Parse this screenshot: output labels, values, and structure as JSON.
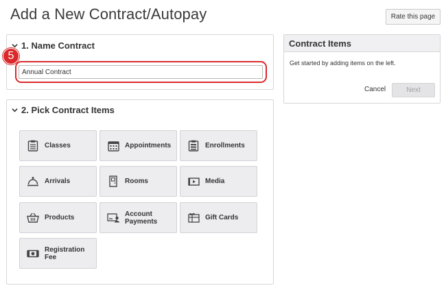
{
  "page": {
    "title": "Add a New Contract/Autopay",
    "rate_button": "Rate this page"
  },
  "name_section": {
    "heading": "1. Name Contract",
    "input_value": "Annual Contract",
    "step_badge": "5",
    "highlight_color": "#d9292b"
  },
  "pick_section": {
    "heading": "2. Pick Contract Items",
    "tiles": [
      {
        "label": "Classes",
        "icon": "clipboard-list-icon"
      },
      {
        "label": "Appointments",
        "icon": "calendar-icon"
      },
      {
        "label": "Enrollments",
        "icon": "clipboard-table-icon"
      },
      {
        "label": "Arrivals",
        "icon": "service-bell-icon"
      },
      {
        "label": "Rooms",
        "icon": "door-icon"
      },
      {
        "label": "Media",
        "icon": "video-icon"
      },
      {
        "label": "Products",
        "icon": "basket-icon"
      },
      {
        "label": "Account Payments",
        "icon": "account-card-icon"
      },
      {
        "label": "Gift Cards",
        "icon": "gift-card-icon"
      },
      {
        "label": "Registration Fee",
        "icon": "cash-icon"
      }
    ]
  },
  "items_panel": {
    "heading": "Contract Items",
    "hint": "Get started by adding items on the left.",
    "cancel_label": "Cancel",
    "next_label": "Next"
  }
}
